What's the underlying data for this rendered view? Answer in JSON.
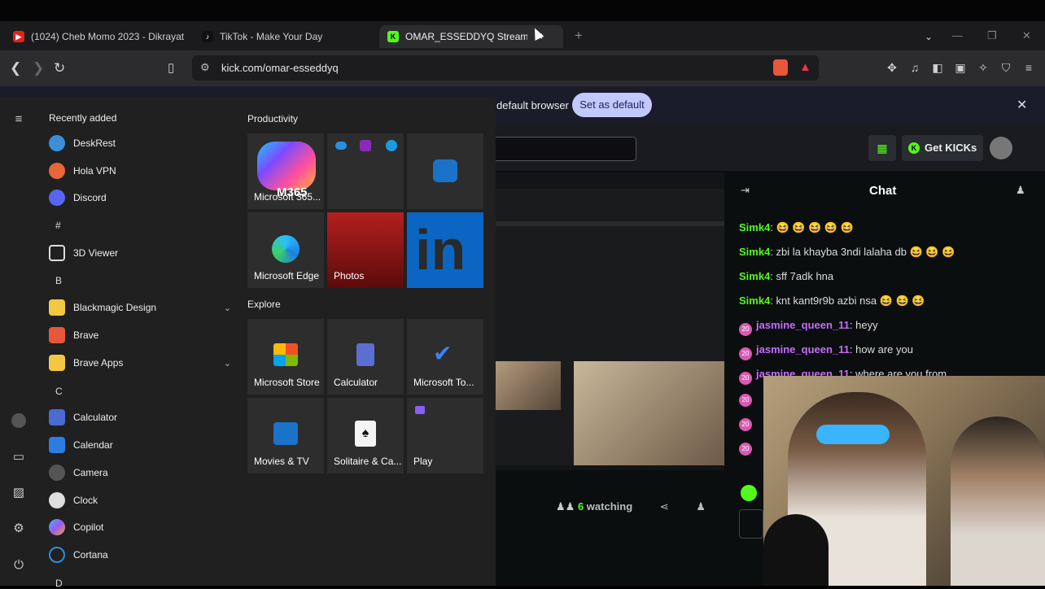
{
  "browser": {
    "tabs": [
      {
        "title": "(1024) Cheb Momo 2023 - Dikrayat"
      },
      {
        "title": "TikTok - Make Your Day"
      },
      {
        "title": "OMAR_ESSEDDYQ Stream - W"
      }
    ],
    "url": "kick.com/omar-esseddyq"
  },
  "infobar": {
    "text": "default browser",
    "button": "Set as default"
  },
  "kick": {
    "get_kicks": "Get KICKs",
    "chat_title": "Chat",
    "messages": [
      {
        "user": "Simk4",
        "text": ": 😆 😆 😆 😆 😆",
        "color": "green"
      },
      {
        "user": "Simk4",
        "text": ": zbi la khayba 3ndi lalaha db 😆 😆 😆",
        "color": "green"
      },
      {
        "user": "Simk4",
        "text": ": sff 7adk hna",
        "color": "green"
      },
      {
        "user": "Simk4",
        "text": ": knt kant9r9b azbi nsa 😆 😆 😆",
        "color": "green"
      },
      {
        "user": "jasmine_queen_11",
        "text": ": heyy",
        "color": "purple"
      },
      {
        "user": "jasmine_queen_11",
        "text": ": how are you",
        "color": "purple"
      },
      {
        "user": "jasmine_queen_11",
        "text": ": where are you from",
        "color": "purple"
      }
    ],
    "watching_count": "6",
    "watching_label": "watching"
  },
  "start_menu": {
    "recently_added": "Recently added",
    "productivity": "Productivity",
    "explore": "Explore",
    "apps": [
      {
        "label": "DeskRest",
        "color": "#3a8fd9"
      },
      {
        "label": "Hola VPN",
        "color": "#e8663a"
      },
      {
        "label": "Discord",
        "color": "#5865f2"
      },
      {
        "letter": "#"
      },
      {
        "label": "3D Viewer",
        "color": "#444"
      },
      {
        "letter": "B"
      },
      {
        "label": "Blackmagic Design",
        "color": "#f2c744"
      },
      {
        "label": "Brave",
        "color": "#e8573a"
      },
      {
        "label": "Brave Apps",
        "color": "#f2c744"
      },
      {
        "letter": "C"
      },
      {
        "label": "Calculator",
        "color": "#4a6bd1"
      },
      {
        "label": "Calendar",
        "color": "#2b7de0"
      },
      {
        "label": "Camera",
        "color": "#555"
      },
      {
        "label": "Clock",
        "color": "#888"
      },
      {
        "label": "Copilot",
        "color": "#5a9be8"
      },
      {
        "label": "Cortana",
        "color": "#2b8fe0"
      },
      {
        "letter": "D"
      }
    ],
    "productivity_tiles": [
      {
        "label": "Microsoft 365...",
        "badge": "M365"
      },
      {
        "label": ""
      },
      {
        "label": ""
      },
      {
        "label": "Microsoft Edge"
      },
      {
        "label": "Photos"
      },
      {
        "label": "",
        "badge": "in"
      }
    ],
    "explore_tiles": [
      {
        "label": "Microsoft Store"
      },
      {
        "label": "Calculator"
      },
      {
        "label": "Microsoft To..."
      },
      {
        "label": "Movies & TV"
      },
      {
        "label": "Solitaire & Ca..."
      },
      {
        "label": "Play"
      }
    ]
  }
}
